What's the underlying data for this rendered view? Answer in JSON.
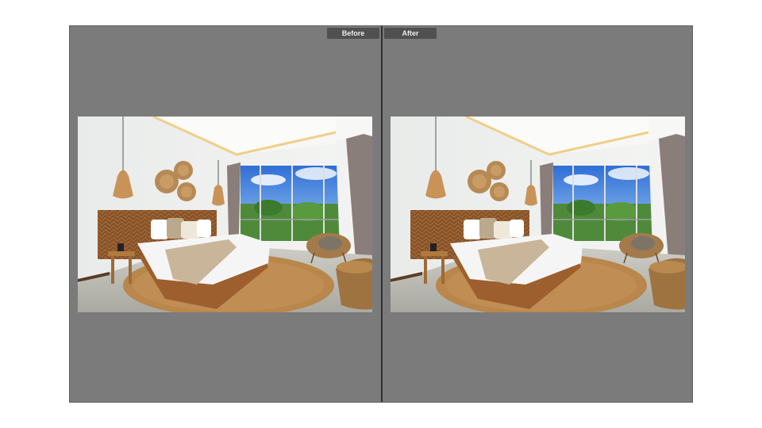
{
  "compare": {
    "before_label": "Before",
    "after_label": "After"
  },
  "colors": {
    "viewer_bg": "#7b7b7b",
    "divider": "#2e2e2e",
    "label_bg": "#505050",
    "label_text": "#ededed"
  }
}
